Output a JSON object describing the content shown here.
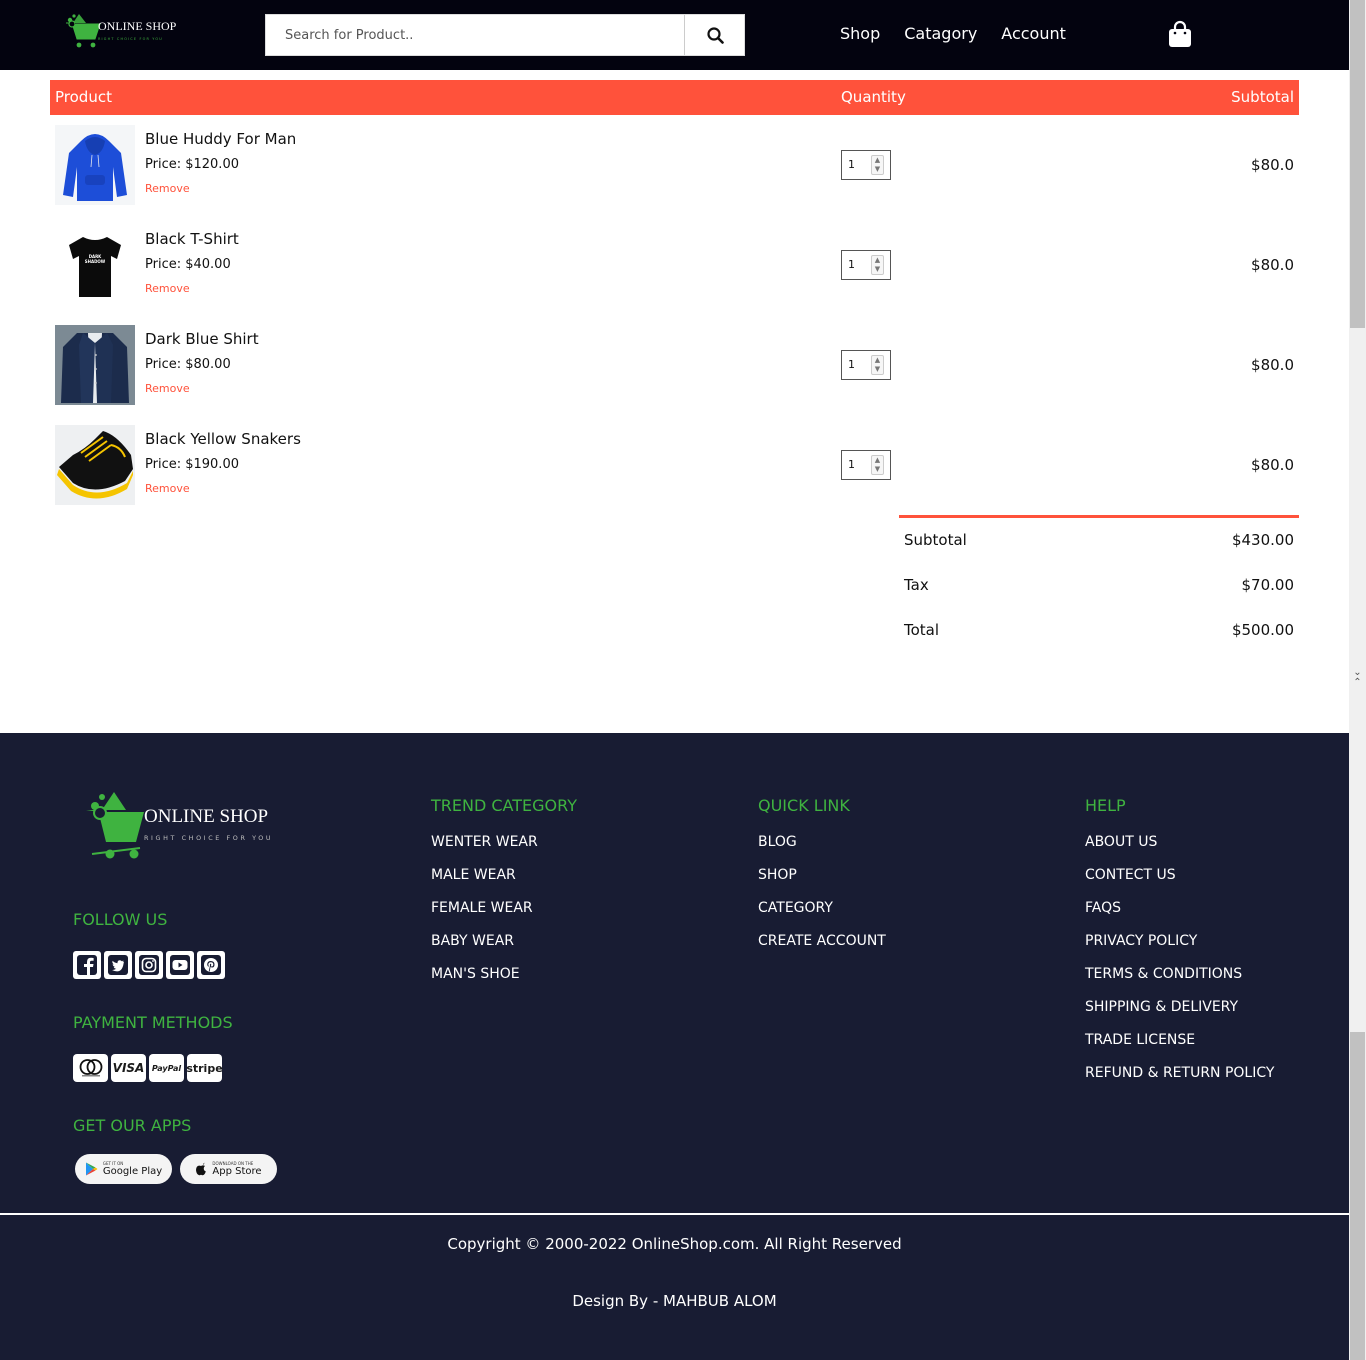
{
  "header": {
    "logo_name": "ONLINE SHOP",
    "logo_tagline": "RIGHT CHOICE FOR YOU",
    "search_placeholder": "Search for Product..",
    "nav": [
      "Shop",
      "Catagory",
      "Account"
    ],
    "icons": {
      "search": "search-icon",
      "cart": "shopping-bag-icon"
    }
  },
  "cart": {
    "columns": {
      "product": "Product",
      "quantity": "Quantity",
      "subtotal": "Subtotal"
    },
    "remove_label": "Remove",
    "items": [
      {
        "name": "Blue Huddy For Man",
        "price": "Price: $120.00",
        "qty": "1",
        "subtotal": "$80.0"
      },
      {
        "name": "Black T-Shirt",
        "price": "Price: $40.00",
        "qty": "1",
        "subtotal": "$80.0"
      },
      {
        "name": "Dark Blue Shirt",
        "price": "Price: $80.00",
        "qty": "1",
        "subtotal": "$80.0"
      },
      {
        "name": "Black Yellow Snakers",
        "price": "Price: $190.00",
        "qty": "1",
        "subtotal": "$80.0"
      }
    ]
  },
  "totals": [
    {
      "label": "Subtotal",
      "value": "$430.00"
    },
    {
      "label": "Tax",
      "value": "$70.00"
    },
    {
      "label": "Total",
      "value": "$500.00"
    }
  ],
  "footer": {
    "logo_name": "ONLINE SHOP",
    "logo_tagline": "RIGHT CHOICE FOR YOU",
    "follow_title": "FOLLOW US",
    "payment_title": "PAYMENT METHODS",
    "payment_methods": [
      "VISA",
      "PayPal",
      "stripe"
    ],
    "apps_title": "GET OUR APPS",
    "apps": [
      {
        "small": "GET IT ON",
        "big": "Google Play"
      },
      {
        "small": "DOWNLOAD ON THE",
        "big": "App Store"
      }
    ],
    "columns": [
      {
        "title": "TREND CATEGORY",
        "links": [
          "WENTER WEAR",
          "MALE WEAR",
          "FEMALE WEAR",
          "BABY WEAR",
          "MAN'S SHOE"
        ]
      },
      {
        "title": "QUICK LINK",
        "links": [
          "BLOG",
          "SHOP",
          "CATEGORY",
          "CREATE ACCOUNT"
        ]
      },
      {
        "title": "HELP",
        "links": [
          "ABOUT US",
          "CONTECT US",
          "FAQS",
          "PRIVACY POLICY",
          "TERMS & CONDITIONS",
          "SHIPPING & DELIVERY",
          "TRADE LICENSE",
          "REFUND & RETURN POLICY"
        ]
      }
    ],
    "copyright": "Copyright © 2000-2022 OnlineShop.com. All Right Reserved",
    "design_by": "Design By - MAHBUB ALOM"
  },
  "colors": {
    "accent": "#ff523b",
    "green": "#3fb340",
    "navbar": "#03030f",
    "footer": "#181c33"
  }
}
